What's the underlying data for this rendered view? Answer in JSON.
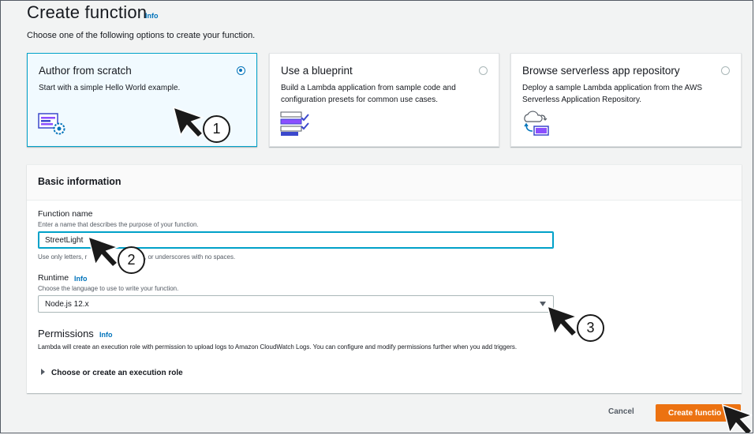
{
  "page": {
    "title": "Create function",
    "title_info": "Info",
    "subtitle": "Choose one of the following options to create your function."
  },
  "options": [
    {
      "title": "Author from scratch",
      "description": "Start with a simple Hello World example.",
      "selected": true,
      "icon": "code-gear-icon"
    },
    {
      "title": "Use a blueprint",
      "description": "Build a Lambda application from sample code and configuration presets for common use cases.",
      "selected": false,
      "icon": "checklist-icon"
    },
    {
      "title": "Browse serverless app repository",
      "description": "Deploy a sample Lambda application from the AWS Serverless Application Repository.",
      "selected": false,
      "icon": "cloud-sync-icon"
    }
  ],
  "basic_info": {
    "header": "Basic information",
    "function_name": {
      "label": "Function name",
      "description": "Enter a name that describes the purpose of your function.",
      "value": "StreetLight",
      "constraint": "Use only letters, numbers, hyphens, or underscores with no spaces.",
      "constraint_visible_left": "Use only letters, r",
      "constraint_visible_right": "s, or underscores with no spaces."
    },
    "runtime": {
      "label": "Runtime",
      "info": "Info",
      "description": "Choose the language to use to write your function.",
      "value": "Node.js 12.x"
    },
    "permissions": {
      "title": "Permissions",
      "info": "Info",
      "description": "Lambda will create an execution role with permission to upload logs to Amazon CloudWatch Logs. You can configure and modify permissions further when you add triggers.",
      "expander": "Choose or create an execution role"
    }
  },
  "actions": {
    "cancel": "Cancel",
    "create": "Create function",
    "create_visible": "Create functio"
  },
  "annotations": [
    "1",
    "2",
    "3"
  ],
  "colors": {
    "accent": "#0073bb",
    "primary_button": "#ec7211",
    "selected_border": "#00a1c9",
    "selected_bg": "#f1faff"
  }
}
